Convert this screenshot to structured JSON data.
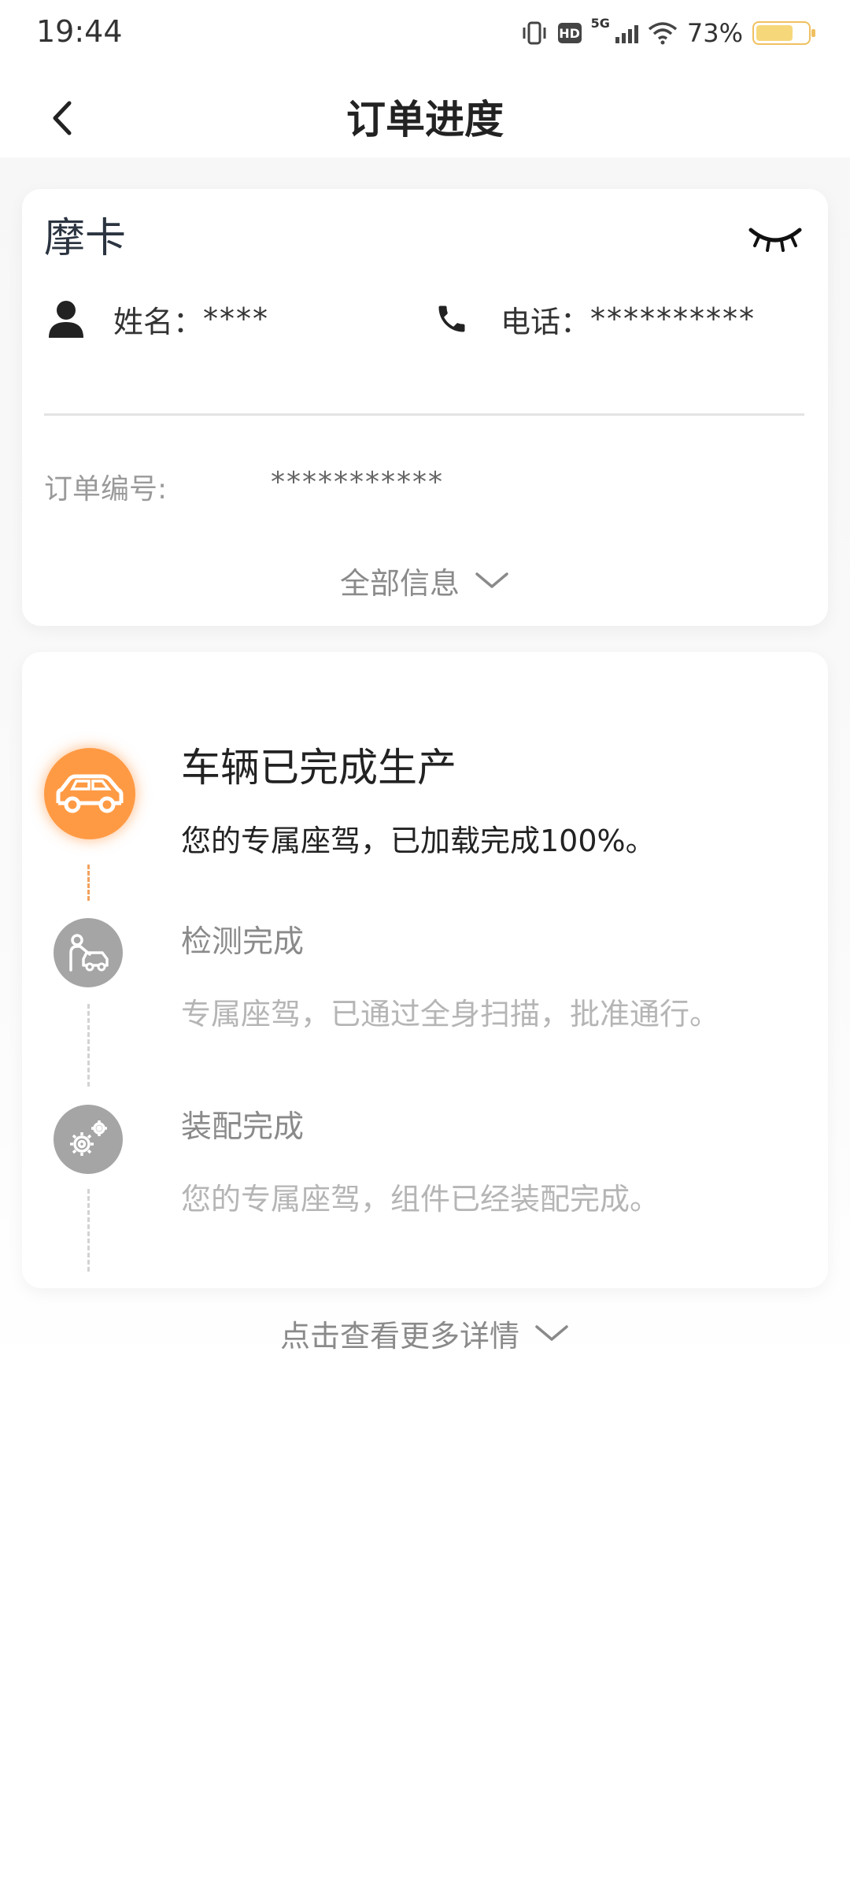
{
  "status_bar": {
    "time": "19:44",
    "network": "5G",
    "hd_label": "HD",
    "battery_percent": "73%",
    "battery_level": 0.73
  },
  "nav": {
    "title": "订单进度"
  },
  "order_card": {
    "brand": "摩卡",
    "name_label": "姓名：",
    "name_value": "****",
    "phone_label": "电话：",
    "phone_value": "**********",
    "order_no_label": "订单编号:",
    "order_no_value": "***********",
    "expand_label": "全部信息"
  },
  "progress": {
    "steps": [
      {
        "title": "车辆已完成生产",
        "desc": "您的专属座驾，已加载完成100%。",
        "icon": "car-icon",
        "active": true
      },
      {
        "title": "检测完成",
        "desc": "专属座驾，已通过全身扫描，批准通行。",
        "icon": "inspection-icon",
        "active": false
      },
      {
        "title": "装配完成",
        "desc": "您的专属座驾，组件已经装配完成。",
        "icon": "gear-icon",
        "active": false
      }
    ],
    "more_label": "点击查看更多详情"
  },
  "colors": {
    "accent": "#ff9a44",
    "inactive": "#a5a5a5",
    "text_dark": "#222222",
    "text_muted": "#8a8a8a"
  }
}
